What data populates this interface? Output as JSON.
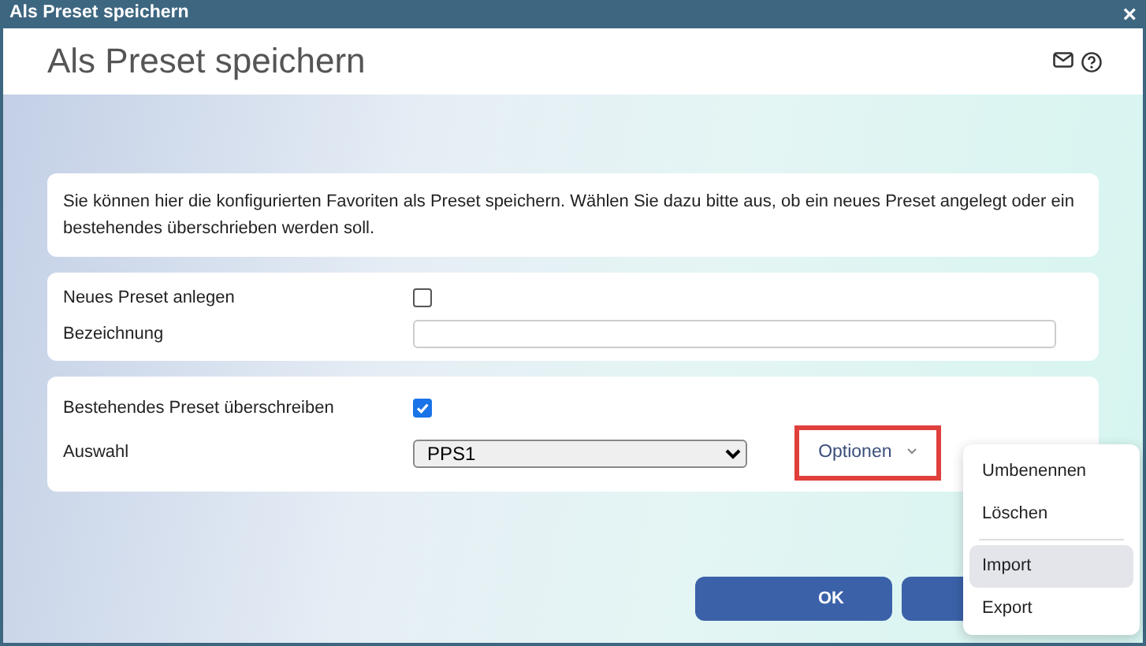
{
  "window": {
    "title": "Als Preset speichern",
    "close": "×"
  },
  "header": {
    "title": "Als Preset speichern"
  },
  "intro": "Sie können hier die konfigurierten Favoriten als Preset speichern. Wählen Sie dazu bitte aus, ob ein neues Preset angelegt oder ein bestehendes überschrieben werden soll.",
  "new_preset": {
    "label": "Neues Preset anlegen",
    "checked": false,
    "name_label": "Bezeichnung"
  },
  "existing_preset": {
    "label": "Bestehendes Preset überschreiben",
    "checked": true,
    "select_label": "Auswahl",
    "select_value": "PPS1",
    "options_button": {
      "label": "Optionen",
      "highlighted": true
    }
  },
  "options_menu": [
    {
      "label": "Umbenennen",
      "selected": false,
      "separator_after": false
    },
    {
      "label": "Löschen",
      "selected": false,
      "separator_after": true
    },
    {
      "label": "Import",
      "selected": true,
      "separator_after": false
    },
    {
      "label": "Export",
      "selected": false,
      "separator_after": false
    }
  ],
  "buttons": [
    {
      "kind": "primary",
      "label": "OK"
    },
    {
      "kind": "primary"
    }
  ]
}
